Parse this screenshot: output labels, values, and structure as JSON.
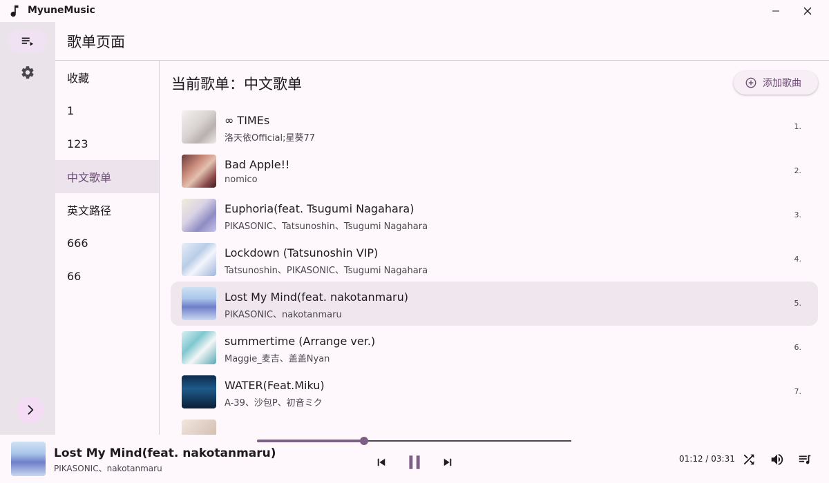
{
  "app": {
    "title": "MyuneMusic"
  },
  "page": {
    "title": "歌单页面"
  },
  "playlists": [
    {
      "label": "收藏",
      "active": false
    },
    {
      "label": "1",
      "active": false
    },
    {
      "label": "123",
      "active": false
    },
    {
      "label": "中文歌单",
      "active": true
    },
    {
      "label": "英文路径",
      "active": false
    },
    {
      "label": "666",
      "active": false
    },
    {
      "label": "66",
      "active": false
    }
  ],
  "main": {
    "current_title": "当前歌单：中文歌单",
    "add_button_label": "添加歌曲"
  },
  "songs": [
    {
      "title": "∞ TIMEs",
      "artist": "洛天依Official;星葵77",
      "index": "1."
    },
    {
      "title": "Bad Apple!!",
      "artist": "nomico",
      "index": "2."
    },
    {
      "title": "Euphoria(feat. Tsugumi Nagahara)",
      "artist": "PIKASONIC、Tatsunoshin、Tsugumi Nagahara",
      "index": "3."
    },
    {
      "title": "Lockdown (Tatsunoshin VIP)",
      "artist": "Tatsunoshin、PIKASONIC、Tsugumi Nagahara",
      "index": "4."
    },
    {
      "title": "Lost My Mind(feat. nakotanmaru)",
      "artist": "PIKASONIC、nakotanmaru",
      "index": "5."
    },
    {
      "title": "summertime (Arrange ver.)",
      "artist": "Maggie_麦吉、盖盖Nyan",
      "index": "6."
    },
    {
      "title": "WATER(Feat.Miku)",
      "artist": "A-39、沙包P、初音ミク",
      "index": "7."
    }
  ],
  "player": {
    "title": "Lost My Mind(feat. nakotanmaru)",
    "artist": "PIKASONIC、nakotanmaru",
    "time": "01:12 / 03:31",
    "progress": 0.34
  },
  "icons": {
    "app": "music-note-icon",
    "minimize": "minimize-icon",
    "close": "close-icon",
    "playlist_nav": "queue-music-icon",
    "settings": "gear-icon",
    "expand": "chevron-right-icon",
    "add": "add-circle-icon",
    "prev": "skip-previous-icon",
    "pause": "pause-icon",
    "next": "skip-next-icon",
    "shuffle": "shuffle-icon",
    "volume": "volume-icon",
    "queue": "queue-icon"
  },
  "colors": {
    "accent": "#7d5e85",
    "rail": "#eae3ea",
    "selected": "#efe6ee",
    "background": "#fef7fb"
  }
}
